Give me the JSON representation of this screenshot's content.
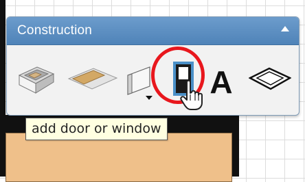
{
  "panel": {
    "title": "Construction",
    "collapse_icon": "chevron-up-icon"
  },
  "tools": [
    {
      "name": "add-room-tool",
      "icon": "room-icon"
    },
    {
      "name": "add-floor-tool",
      "icon": "floor-icon"
    },
    {
      "name": "add-wall-tool",
      "icon": "wall-icon"
    },
    {
      "name": "add-door-window-tool",
      "icon": "door-window-icon",
      "highlighted": true
    },
    {
      "name": "add-text-tool",
      "icon": "text-icon",
      "glyph": "A"
    },
    {
      "name": "add-dimension-tool",
      "icon": "dimension-icon"
    }
  ],
  "tooltip": {
    "text": "add door or window"
  },
  "colors": {
    "header": "#5a8cc0",
    "highlight_ring": "#e8171d",
    "floor": "#efc08a",
    "tooltip_bg": "#ffffe1"
  }
}
